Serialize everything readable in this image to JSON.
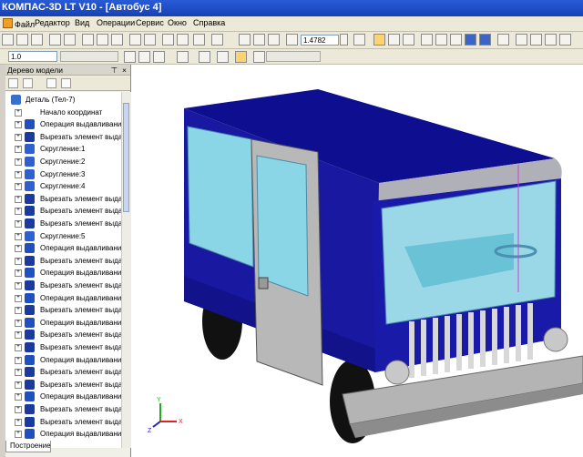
{
  "window": {
    "title": "КОМПАС-3D LT V10 - [Автобус 4]"
  },
  "menu": [
    {
      "label": "Файл",
      "icon": "doc-icon"
    },
    {
      "label": "Редактор"
    },
    {
      "label": "Вид"
    },
    {
      "label": "Операции"
    },
    {
      "label": "Сервис"
    },
    {
      "label": "Окно"
    },
    {
      "label": "Справка"
    }
  ],
  "toolbar": {
    "zoom_value": "1.4782",
    "scale_value": "1.0"
  },
  "tree_panel": {
    "title": "Дерево модели",
    "bottom_tab": "Построение",
    "items": [
      {
        "label": "Деталь (Тел-7)",
        "icon": "part-icon",
        "level": 0
      },
      {
        "label": "Начало координат",
        "icon": "axes-icon",
        "level": 1
      },
      {
        "label": "Операция выдавливания",
        "icon": "extrude-icon",
        "level": 1
      },
      {
        "label": "Вырезать элемент выдавливания",
        "icon": "cut-icon",
        "level": 1
      },
      {
        "label": "Скругление:1",
        "icon": "fillet-icon",
        "level": 1
      },
      {
        "label": "Скругление:2",
        "icon": "fillet-icon",
        "level": 1
      },
      {
        "label": "Скругление:3",
        "icon": "fillet-icon",
        "level": 1
      },
      {
        "label": "Скругление:4",
        "icon": "fillet-icon",
        "level": 1
      },
      {
        "label": "Вырезать элемент выдавливания",
        "icon": "cut-icon",
        "level": 1
      },
      {
        "label": "Вырезать элемент выдавливания",
        "icon": "cut-icon",
        "level": 1
      },
      {
        "label": "Вырезать элемент выдавливания",
        "icon": "cut-icon",
        "level": 1
      },
      {
        "label": "Скругление:5",
        "icon": "fillet-icon",
        "level": 1
      },
      {
        "label": "Операция выдавливания",
        "icon": "extrude-icon",
        "level": 1
      },
      {
        "label": "Вырезать элемент выдавливания",
        "icon": "cut-icon",
        "level": 1
      },
      {
        "label": "Операция выдавливания",
        "icon": "extrude-icon",
        "level": 1
      },
      {
        "label": "Вырезать элемент выдавливания",
        "icon": "cut-icon",
        "level": 1
      },
      {
        "label": "Операция выдавливания",
        "icon": "extrude-icon",
        "level": 1
      },
      {
        "label": "Вырезать элемент выдавливания",
        "icon": "cut-icon",
        "level": 1
      },
      {
        "label": "Операция выдавливания",
        "icon": "extrude-icon",
        "level": 1
      },
      {
        "label": "Вырезать элемент выдавливания",
        "icon": "cut-icon",
        "level": 1
      },
      {
        "label": "Вырезать элемент выдавливания",
        "icon": "cut-icon",
        "level": 1
      },
      {
        "label": "Операция выдавливания",
        "icon": "extrude-icon",
        "level": 1
      },
      {
        "label": "Вырезать элемент выдавливания",
        "icon": "cut-icon",
        "level": 1
      },
      {
        "label": "Вырезать элемент выдавливания",
        "icon": "cut-icon",
        "level": 1
      },
      {
        "label": "Операция выдавливания",
        "icon": "extrude-icon",
        "level": 1
      },
      {
        "label": "Вырезать элемент выдавливания",
        "icon": "cut-icon",
        "level": 1
      },
      {
        "label": "Вырезать элемент выдавливания",
        "icon": "cut-icon",
        "level": 1
      },
      {
        "label": "Операция выдавливания",
        "icon": "extrude-icon",
        "level": 1
      }
    ]
  },
  "viewport": {
    "model": "bus-3d-model",
    "body_color": "#1a1aa8",
    "glass_color": "#8ad6e6",
    "bumper_color": "#b4b4b4",
    "triad_labels": {
      "x": "X",
      "y": "Y",
      "z": "Z"
    }
  }
}
